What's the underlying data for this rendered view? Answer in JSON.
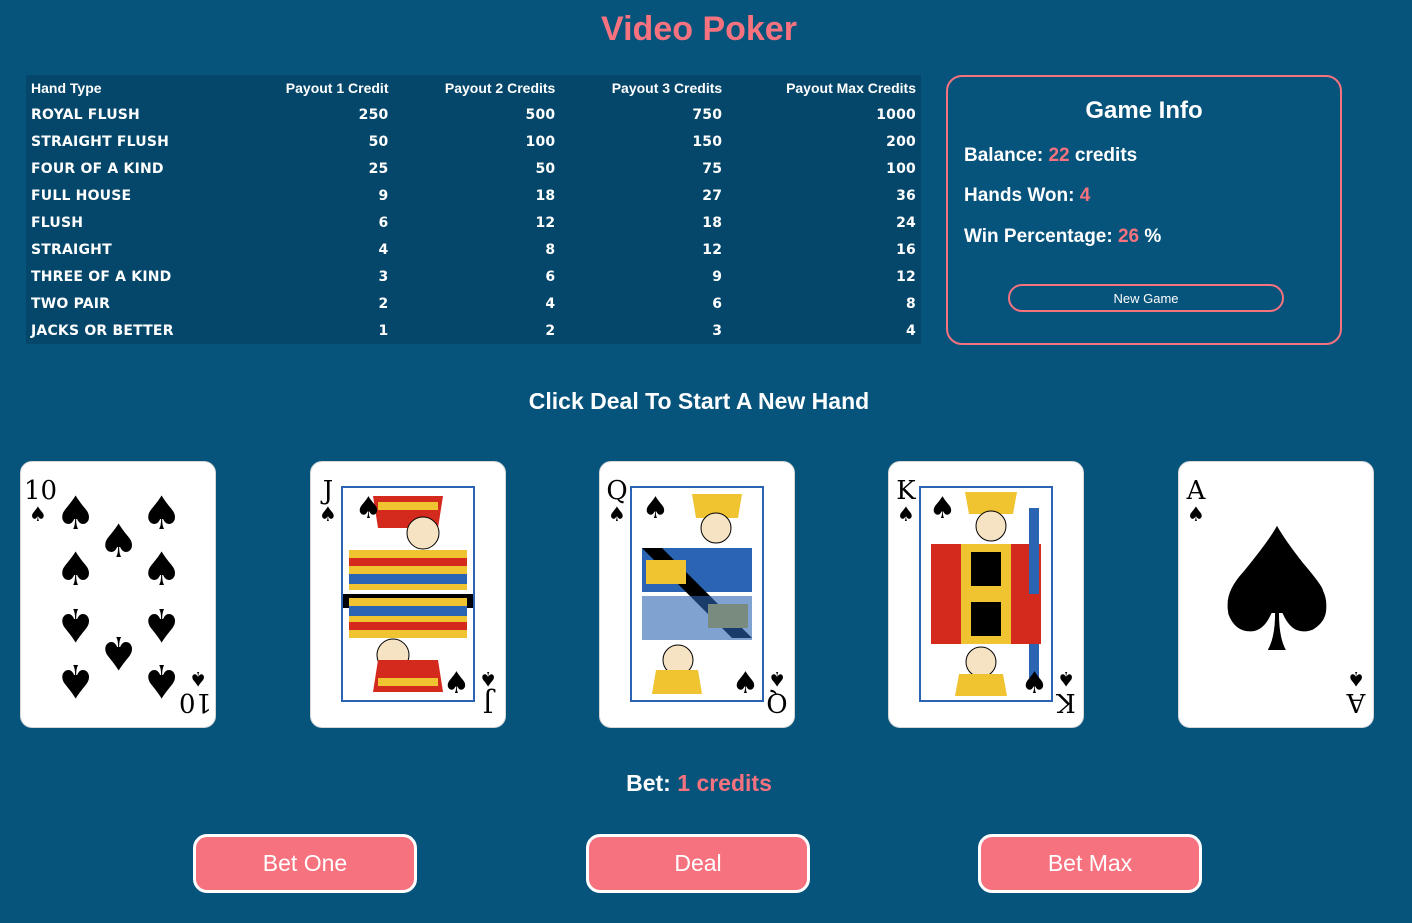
{
  "title": "Video Poker",
  "paytable": {
    "headers": [
      "Hand Type",
      "Payout 1 Credit",
      "Payout 2 Credits",
      "Payout 3 Credits",
      "Payout Max Credits"
    ],
    "rows": [
      [
        "ROYAL FLUSH",
        "250",
        "500",
        "750",
        "1000"
      ],
      [
        "STRAIGHT FLUSH",
        "50",
        "100",
        "150",
        "200"
      ],
      [
        "FOUR OF A KIND",
        "25",
        "50",
        "75",
        "100"
      ],
      [
        "FULL HOUSE",
        "9",
        "18",
        "27",
        "36"
      ],
      [
        "FLUSH",
        "6",
        "12",
        "18",
        "24"
      ],
      [
        "STRAIGHT",
        "4",
        "8",
        "12",
        "16"
      ],
      [
        "THREE OF A KIND",
        "3",
        "6",
        "9",
        "12"
      ],
      [
        "TWO PAIR",
        "2",
        "4",
        "6",
        "8"
      ],
      [
        "JACKS OR BETTER",
        "1",
        "2",
        "3",
        "4"
      ]
    ]
  },
  "game_info": {
    "heading": "Game Info",
    "balance_label": "Balance:",
    "balance_value": "22",
    "balance_unit": "credits",
    "hands_won_label": "Hands Won:",
    "hands_won_value": "4",
    "win_pct_label": "Win Percentage:",
    "win_pct_value": "26",
    "win_pct_unit": "%",
    "new_game_label": "New Game"
  },
  "status": "Click Deal To Start A New Hand",
  "cards": [
    {
      "rank": "10",
      "suit": "♠",
      "icon": "spade-icon"
    },
    {
      "rank": "J",
      "suit": "♠",
      "icon": "spade-icon"
    },
    {
      "rank": "Q",
      "suit": "♠",
      "icon": "spade-icon"
    },
    {
      "rank": "K",
      "suit": "♠",
      "icon": "spade-icon"
    },
    {
      "rank": "A",
      "suit": "♠",
      "icon": "spade-icon"
    }
  ],
  "bet": {
    "label": "Bet:",
    "value": "1",
    "unit": "credits"
  },
  "buttons": {
    "bet_one": "Bet One",
    "deal": "Deal",
    "bet_max": "Bet Max"
  },
  "colors": {
    "background": "#06547c",
    "accent": "#f7727f",
    "table_bg": "#05476a",
    "face_border": "#2a64b2"
  }
}
